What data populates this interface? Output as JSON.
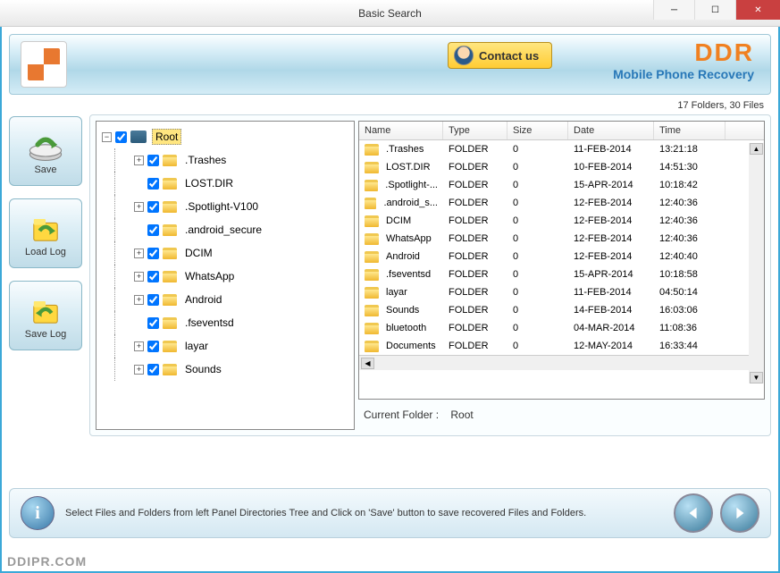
{
  "window": {
    "title": "Basic Search"
  },
  "header": {
    "contact_label": "Contact us",
    "brand": "DDR",
    "brand_sub": "Mobile Phone Recovery"
  },
  "status": {
    "folders": 17,
    "files": 30,
    "text": "17 Folders, 30 Files"
  },
  "sidebar": {
    "save": "Save",
    "load_log": "Load Log",
    "save_log": "Save Log"
  },
  "tree": {
    "root_label": "Root",
    "items": [
      {
        "label": ".Trashes",
        "expandable": true
      },
      {
        "label": "LOST.DIR",
        "expandable": false
      },
      {
        "label": ".Spotlight-V100",
        "expandable": true
      },
      {
        "label": ".android_secure",
        "expandable": false
      },
      {
        "label": "DCIM",
        "expandable": true
      },
      {
        "label": "WhatsApp",
        "expandable": true
      },
      {
        "label": "Android",
        "expandable": true
      },
      {
        "label": ".fseventsd",
        "expandable": false
      },
      {
        "label": "layar",
        "expandable": true
      },
      {
        "label": "Sounds",
        "expandable": true
      }
    ]
  },
  "columns": {
    "name": "Name",
    "type": "Type",
    "size": "Size",
    "date": "Date",
    "time": "Time"
  },
  "rows": [
    {
      "name": ".Trashes",
      "type": "FOLDER",
      "size": "0",
      "date": "11-FEB-2014",
      "time": "13:21:18"
    },
    {
      "name": "LOST.DIR",
      "type": "FOLDER",
      "size": "0",
      "date": "10-FEB-2014",
      "time": "14:51:30"
    },
    {
      "name": ".Spotlight-...",
      "type": "FOLDER",
      "size": "0",
      "date": "15-APR-2014",
      "time": "10:18:42"
    },
    {
      "name": ".android_s...",
      "type": "FOLDER",
      "size": "0",
      "date": "12-FEB-2014",
      "time": "12:40:36"
    },
    {
      "name": "DCIM",
      "type": "FOLDER",
      "size": "0",
      "date": "12-FEB-2014",
      "time": "12:40:36"
    },
    {
      "name": "WhatsApp",
      "type": "FOLDER",
      "size": "0",
      "date": "12-FEB-2014",
      "time": "12:40:36"
    },
    {
      "name": "Android",
      "type": "FOLDER",
      "size": "0",
      "date": "12-FEB-2014",
      "time": "12:40:40"
    },
    {
      "name": ".fseventsd",
      "type": "FOLDER",
      "size": "0",
      "date": "15-APR-2014",
      "time": "10:18:58"
    },
    {
      "name": "layar",
      "type": "FOLDER",
      "size": "0",
      "date": "11-FEB-2014",
      "time": "04:50:14"
    },
    {
      "name": "Sounds",
      "type": "FOLDER",
      "size": "0",
      "date": "14-FEB-2014",
      "time": "16:03:06"
    },
    {
      "name": "bluetooth",
      "type": "FOLDER",
      "size": "0",
      "date": "04-MAR-2014",
      "time": "11:08:36"
    },
    {
      "name": "Documents",
      "type": "FOLDER",
      "size": "0",
      "date": "12-MAY-2014",
      "time": "16:33:44"
    }
  ],
  "current_folder": {
    "label": "Current Folder :",
    "value": "Root"
  },
  "footer": {
    "hint": "Select Files and Folders from left Panel Directories Tree and Click on 'Save' button to save recovered Files and Folders."
  },
  "watermark": "DDIPR.COM"
}
